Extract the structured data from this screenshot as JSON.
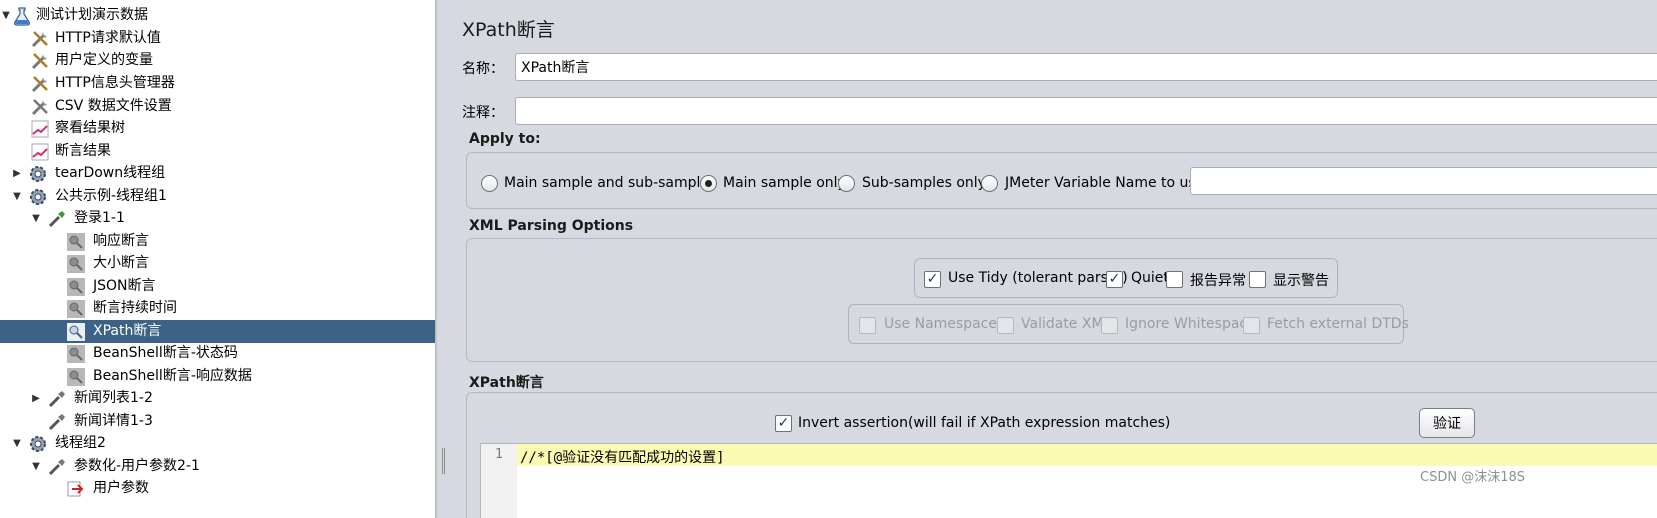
{
  "tree": {
    "items": [
      {
        "label": "测试计划演示数据",
        "icon": "test-plan-flask-icon",
        "toggle": "▼"
      },
      {
        "label": "HTTP请求默认值",
        "icon": "config-wrench-icon",
        "toggle": ""
      },
      {
        "label": "用户定义的变量",
        "icon": "config-wrench-icon",
        "toggle": ""
      },
      {
        "label": "HTTP信息头管理器",
        "icon": "config-wrench-icon",
        "toggle": ""
      },
      {
        "label": "CSV 数据文件设置",
        "icon": "config-wrench-icon",
        "toggle": ""
      },
      {
        "label": "察看结果树",
        "icon": "listener-graph-icon",
        "toggle": ""
      },
      {
        "label": "断言结果",
        "icon": "listener-graph-icon",
        "toggle": ""
      },
      {
        "label": "tearDown线程组",
        "icon": "thread-group-gear-icon",
        "toggle": "▶"
      },
      {
        "label": "公共示例-线程组1",
        "icon": "thread-group-gear-icon",
        "toggle": "▼"
      },
      {
        "label": "登录1-1",
        "icon": "sampler-pipette-icon",
        "toggle": "▼"
      },
      {
        "label": "响应断言",
        "icon": "assertion-magnifier-icon",
        "toggle": ""
      },
      {
        "label": "大小断言",
        "icon": "assertion-magnifier-icon",
        "toggle": ""
      },
      {
        "label": "JSON断言",
        "icon": "assertion-magnifier-icon",
        "toggle": ""
      },
      {
        "label": "断言持续时间",
        "icon": "assertion-magnifier-icon",
        "toggle": ""
      },
      {
        "label": "XPath断言",
        "icon": "assertion-magnifier-icon",
        "toggle": "",
        "selected": true
      },
      {
        "label": "BeanShell断言-状态码",
        "icon": "assertion-magnifier-icon",
        "toggle": ""
      },
      {
        "label": "BeanShell断言-响应数据",
        "icon": "assertion-magnifier-icon",
        "toggle": ""
      },
      {
        "label": "新闻列表1-2",
        "icon": "sampler-pipette-icon",
        "toggle": "▶"
      },
      {
        "label": "新闻详情1-3",
        "icon": "sampler-pipette-icon",
        "toggle": ""
      },
      {
        "label": "线程组2",
        "icon": "thread-group-gear-icon",
        "toggle": "▼"
      },
      {
        "label": "参数化-用户参数2-1",
        "icon": "sampler-pipette-icon",
        "toggle": "▼"
      },
      {
        "label": "用户参数",
        "icon": "preprocessor-red-icon",
        "toggle": ""
      }
    ]
  },
  "editor": {
    "title": "XPath断言",
    "name_label": "名称：",
    "name_value": "XPath断言",
    "comment_label": "注释：",
    "comment_value": ""
  },
  "apply_to": {
    "title": "Apply to:",
    "options": [
      {
        "label": "Main sample and sub-samples",
        "checked": false
      },
      {
        "label": "Main sample only",
        "checked": true
      },
      {
        "label": "Sub-samples only",
        "checked": false
      },
      {
        "label": "JMeter Variable Name to use",
        "checked": false
      }
    ],
    "variable_value": ""
  },
  "xml_parsing": {
    "title": "XML Parsing Options",
    "tidy_options": [
      {
        "label": "Use Tidy (tolerant parser)",
        "checked": true
      },
      {
        "label": "Quiet",
        "checked": true
      },
      {
        "label": "报告异常",
        "checked": false
      },
      {
        "label": "显示警告",
        "checked": false
      }
    ],
    "namespace_options": [
      {
        "label": "Use Namespaces",
        "checked": false
      },
      {
        "label": "Validate XML",
        "checked": false
      },
      {
        "label": "Ignore Whitespace",
        "checked": false
      },
      {
        "label": "Fetch external DTDs",
        "checked": false
      }
    ]
  },
  "xpath_section": {
    "title": "XPath断言",
    "invert_label": "Invert assertion(will fail if XPath expression matches)",
    "invert_checked": true,
    "validate_button": "验证",
    "line_number": "1",
    "expression": "//*[@验证没有匹配成功的设置]"
  },
  "watermark": "CSDN @沫沫18S",
  "colors": {
    "selected_row": "#3c6286",
    "panel_bg": "#d6d9df",
    "code_highlight": "#fbfab2"
  }
}
